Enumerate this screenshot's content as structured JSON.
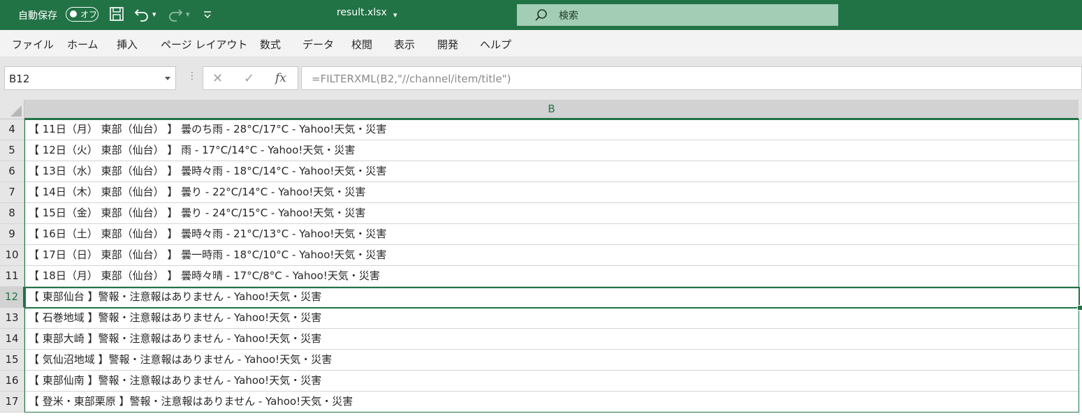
{
  "titlebar": {
    "autosave_label": "自動保存",
    "autosave_state": "オフ",
    "filename": "result.xlsx",
    "search_label": "検索"
  },
  "menu": [
    "ファイル",
    "ホーム",
    "挿入",
    "ページ レイアウト",
    "数式",
    "データ",
    "校閲",
    "表示",
    "開発",
    "ヘルプ"
  ],
  "formula_bar": {
    "name_box": "B12",
    "formula": "=FILTERXML(B2,\"//channel/item/title\")"
  },
  "grid": {
    "column_header": "B",
    "rows": [
      {
        "num": "4",
        "text": "【 11日（月） 東部（仙台） 】 曇のち雨 - 28°C/17°C - Yahoo!天気・災害"
      },
      {
        "num": "5",
        "text": "【 12日（火） 東部（仙台） 】 雨 - 17°C/14°C - Yahoo!天気・災害"
      },
      {
        "num": "6",
        "text": "【 13日（水） 東部（仙台） 】 曇時々雨 - 18°C/14°C - Yahoo!天気・災害"
      },
      {
        "num": "7",
        "text": "【 14日（木） 東部（仙台） 】 曇り - 22°C/14°C - Yahoo!天気・災害"
      },
      {
        "num": "8",
        "text": "【 15日（金） 東部（仙台） 】 曇り - 24°C/15°C - Yahoo!天気・災害"
      },
      {
        "num": "9",
        "text": "【 16日（土） 東部（仙台） 】 曇時々雨 - 21°C/13°C - Yahoo!天気・災害"
      },
      {
        "num": "10",
        "text": "【 17日（日） 東部（仙台） 】 曇一時雨 - 18°C/10°C - Yahoo!天気・災害"
      },
      {
        "num": "11",
        "text": "【 18日（月） 東部（仙台） 】 曇時々晴 - 17°C/8°C - Yahoo!天気・災害"
      },
      {
        "num": "12",
        "text": "【 東部仙台 】警報・注意報はありません - Yahoo!天気・災害"
      },
      {
        "num": "13",
        "text": "【 石巻地域 】警報・注意報はありません - Yahoo!天気・災害"
      },
      {
        "num": "14",
        "text": "【 東部大崎 】警報・注意報はありません - Yahoo!天気・災害"
      },
      {
        "num": "15",
        "text": "【 気仙沼地域 】警報・注意報はありません - Yahoo!天気・災害"
      },
      {
        "num": "16",
        "text": "【 東部仙南 】警報・注意報はありません - Yahoo!天気・災害"
      },
      {
        "num": "17",
        "text": "【 登米・東部栗原 】警報・注意報はありません - Yahoo!天気・災害"
      }
    ]
  },
  "colors": {
    "brand": "#217346",
    "search_box": "#a3cdb4"
  }
}
